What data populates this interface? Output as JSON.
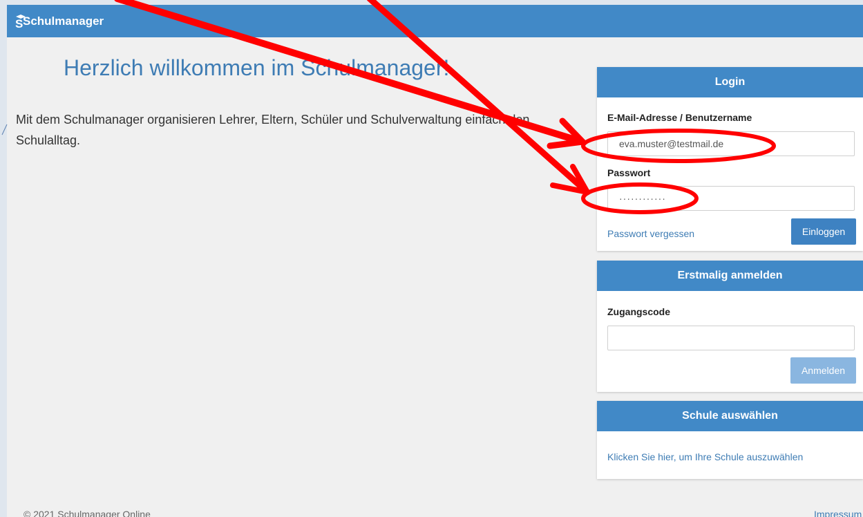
{
  "app": {
    "brand": "Schulmanager"
  },
  "welcome": {
    "title": "Herzlich willkommen im Schulmanager!",
    "text": "Mit dem Schulmanager organisieren Lehrer, Eltern, Schüler und Schulverwaltung einfach den Schulalltag."
  },
  "login": {
    "header": "Login",
    "email_label": "E-Mail-Adresse / Benutzername",
    "email_value": "eva.muster@testmail.de",
    "password_label": "Passwort",
    "password_value": "············",
    "forgot_link": "Passwort vergessen",
    "submit": "Einloggen"
  },
  "first_login": {
    "header": "Erstmalig anmelden",
    "code_label": "Zugangscode",
    "code_value": "",
    "submit": "Anmelden"
  },
  "school": {
    "header": "Schule auswählen",
    "link": "Klicken Sie hier, um Ihre Schule auszuwählen"
  },
  "footer": {
    "copyright": "© 2021 Schulmanager Online",
    "imprint": "Impressum"
  },
  "colors": {
    "primary": "#4189c7",
    "annotation": "#ff0000"
  },
  "icons": {
    "brand": "graduation-cap-icon"
  }
}
